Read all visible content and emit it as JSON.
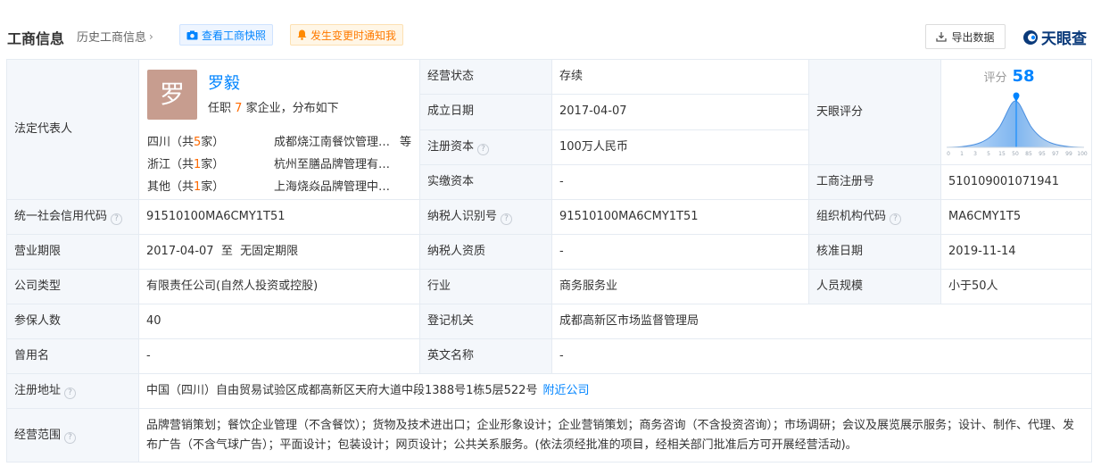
{
  "header": {
    "title": "工商信息",
    "history": "历史工商信息",
    "snapshot": "查看工商快照",
    "notify": "发生变更时通知我",
    "export": "导出数据",
    "logo": "天眼查"
  },
  "rep": {
    "label": "法定代表人",
    "avatar": "罗",
    "name": "罗毅",
    "serve_prefix": "任职",
    "serve_count": "7",
    "serve_suffix": "家企业，分布如下",
    "regions": [
      {
        "name_pre": "四川（共",
        "count": "5",
        "name_post": "家）",
        "company": "成都烧江南餐饮管理…",
        "more": "等"
      },
      {
        "name_pre": "浙江（共",
        "count": "1",
        "name_post": "家）",
        "company": "杭州至膳品牌管理有…",
        "more": ""
      },
      {
        "name_pre": "其他（共",
        "count": "1",
        "name_post": "家）",
        "company": "上海烧焱品牌管理中…",
        "more": ""
      }
    ]
  },
  "fields": {
    "status_label": "经营状态",
    "status": "存续",
    "found_label": "成立日期",
    "found": "2017-04-07",
    "capital_label": "注册资本",
    "capital": "100万人民币",
    "paid_label": "实缴资本",
    "paid": "-",
    "score_label": "天眼评分",
    "score_title": "评分",
    "score_value": "58",
    "score_ticks": [
      "0",
      "1",
      "3",
      "5",
      "15",
      "50",
      "85",
      "95",
      "97",
      "99",
      "100"
    ],
    "regno_label": "工商注册号",
    "regno": "510109001071941",
    "credit_label": "统一社会信用代码",
    "credit": "91510100MA6CMY1T51",
    "taxid_label": "纳税人识别号",
    "taxid": "91510100MA6CMY1T51",
    "org_label": "组织机构代码",
    "org": "MA6CMY1T5",
    "term_label": "营业期限",
    "term": "2017-04-07  至  无固定期限",
    "taxq_label": "纳税人资质",
    "taxq": "-",
    "approve_label": "核准日期",
    "approve": "2019-11-14",
    "type_label": "公司类型",
    "type": "有限责任公司(自然人投资或控股)",
    "industry_label": "行业",
    "industry": "商务服务业",
    "staff_label": "人员规模",
    "staff": "小于50人",
    "insured_label": "参保人数",
    "insured": "40",
    "authority_label": "登记机关",
    "authority": "成都高新区市场监督管理局",
    "former_label": "曾用名",
    "former": "-",
    "english_label": "英文名称",
    "english": "-",
    "address_label": "注册地址",
    "address": "中国（四川）自由贸易试验区成都高新区天府大道中段1388号1栋5层522号",
    "nearby": "附近公司",
    "scope_label": "经营范围",
    "scope": "品牌营销策划；餐饮企业管理（不含餐饮）；货物及技术进出口；企业形象设计；企业营销策划；商务咨询（不含投资咨询）；市场调研；会议及展览展示服务；设计、制作、代理、发布广告（不含气球广告）；平面设计；包装设计；网页设计；公共关系服务。(依法须经批准的项目，经相关部门批准后方可开展经营活动)。"
  },
  "colors": {
    "accent": "#0084ff",
    "count": "#ff6a00",
    "label_bg": "#f4f7fb",
    "border": "#e5ebf2"
  }
}
